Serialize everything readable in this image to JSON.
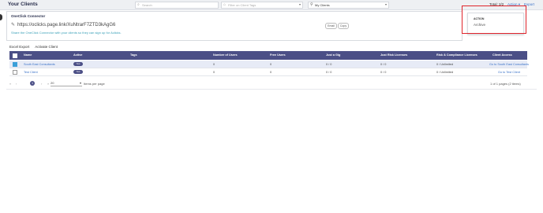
{
  "header": {
    "title": "Your Clients",
    "search_placeholder": "Search",
    "filter_tag_placeholder": "Filter on Client Tags",
    "clients_filter_value": "My Clients",
    "total": "Total: 2/2",
    "action_label": "Action",
    "export_label": "Export"
  },
  "connector": {
    "title": "OneClick Connector",
    "link": "https://oclicks.page.link/XuNtrarF7ZTD3kAgG6",
    "description": "Share the OneClick Connector with your clients so they can sign up for Aclicks.",
    "email_button": "Email",
    "copy_button": "Copy"
  },
  "action_menu": {
    "header": "ACTION",
    "items": [
      "Archive"
    ]
  },
  "toolbar": {
    "excel_export": "Excel Export",
    "activate_client": "Activate Client"
  },
  "table": {
    "columns": [
      "Name",
      "Active",
      "Tags",
      "Number of Users",
      "Free Users",
      "Just a Gig",
      "Just Risk Licenses",
      "Risk & Compliance Licenses",
      "Client Access"
    ],
    "rows": [
      {
        "name": "South East Consultants",
        "active": "Yes",
        "tags": "",
        "users": "0",
        "free": "0",
        "gig": "0 / 0",
        "risk": "0 / 0",
        "compliance": "0 / Unlimited",
        "access": "Go to South East Consultants",
        "checked": true
      },
      {
        "name": "Test Client",
        "active": "Yes",
        "tags": "",
        "users": "0",
        "free": "0",
        "gig": "0 / 0",
        "risk": "0 / 0",
        "compliance": "0 / Unlimited",
        "access": "Go to Test Client",
        "checked": false
      }
    ]
  },
  "pagination": {
    "current_page": "1",
    "per_page": "20",
    "per_page_label": "Items per page",
    "info": "1 of 1 pages (2 items)"
  },
  "colors": {
    "header_bg": "#4b4f86",
    "highlight": "#e0242b",
    "link": "#3b73c8"
  }
}
